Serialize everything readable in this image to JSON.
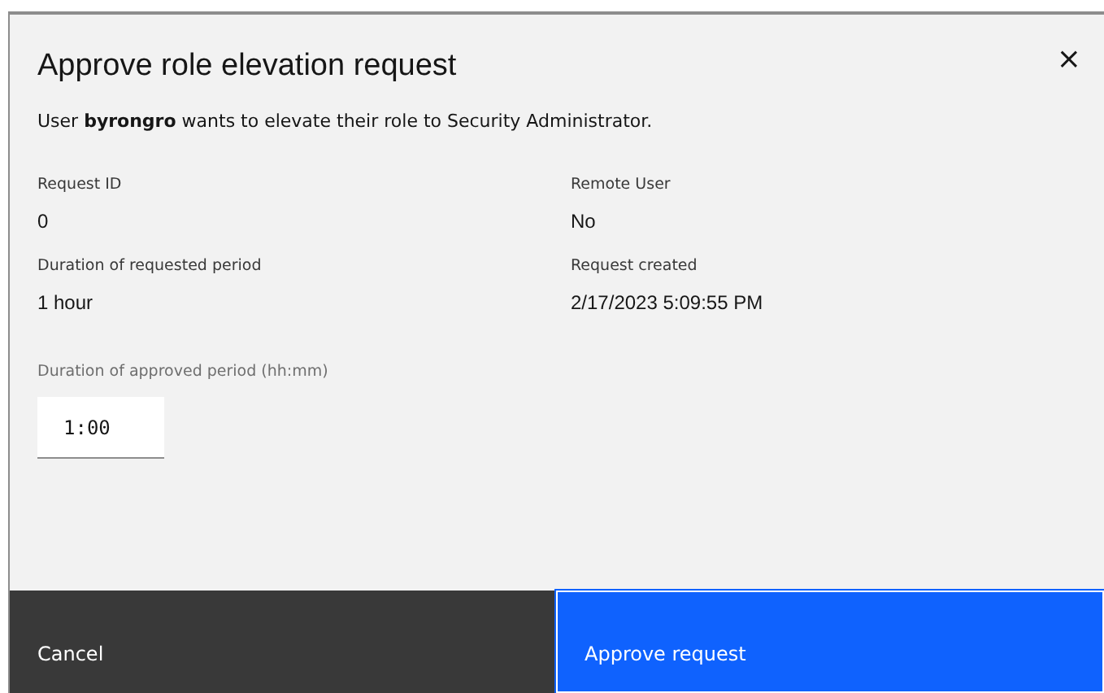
{
  "dialog": {
    "title": "Approve role elevation request",
    "close": "×",
    "description": "User **byrongro** wants to elevate their role to Security Administrator.",
    "details": [
      {
        "label": "Request ID",
        "value": "0"
      },
      {
        "label": "Remote User",
        "value": "No"
      },
      {
        "label": "Duration of requested period",
        "value": "1 hour"
      },
      {
        "label": "Request created",
        "value": "2/17/2023 5:09:55 PM"
      }
    ],
    "approved_period": {
      "label": "Duration of approved period (hh:mm)",
      "value": "1:00"
    },
    "buttons": [
      {
        "kind": "secondary",
        "label": "Cancel"
      },
      {
        "kind": "primary",
        "label": "Approve request"
      }
    ]
  }
}
